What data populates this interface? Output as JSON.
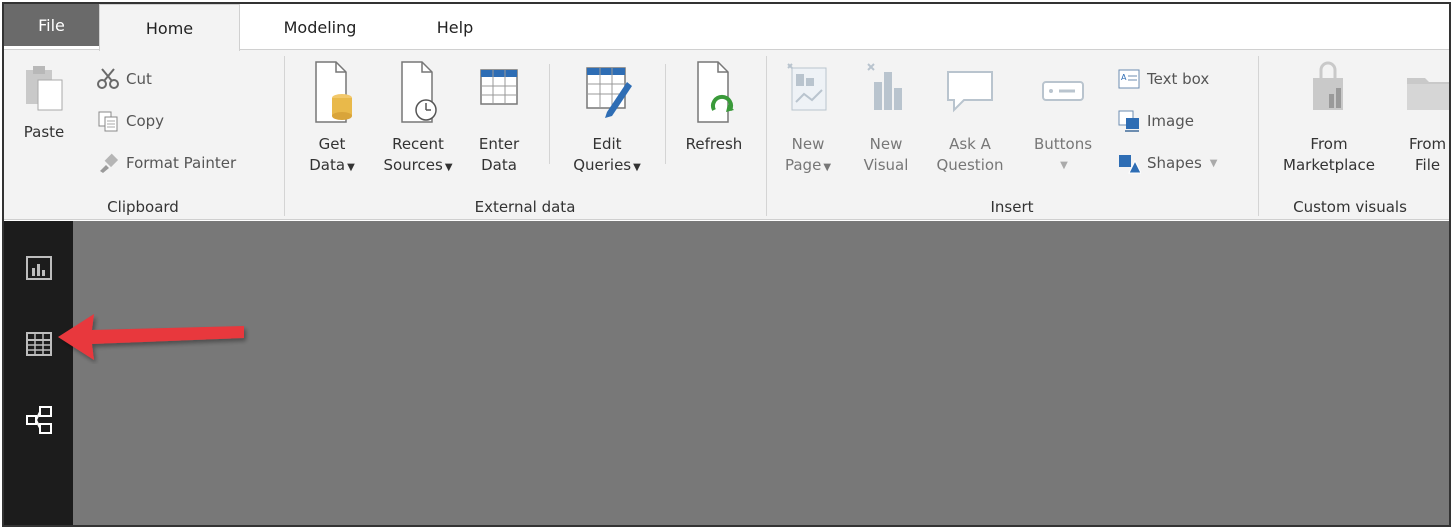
{
  "tabs": [
    {
      "label": "File"
    },
    {
      "label": "Home"
    },
    {
      "label": "Modeling"
    },
    {
      "label": "Help"
    }
  ],
  "active_tab": "Home",
  "clipboard": {
    "paste": "Paste",
    "cut": "Cut",
    "copy": "Copy",
    "format_painter": "Format Painter",
    "label": "Clipboard"
  },
  "external_data": {
    "get_data": [
      "Get",
      "Data"
    ],
    "recent_sources": [
      "Recent",
      "Sources"
    ],
    "enter_data": [
      "Enter",
      "Data"
    ],
    "edit_queries": [
      "Edit",
      "Queries"
    ],
    "refresh": "Refresh",
    "label": "External data"
  },
  "insert": {
    "new_page": [
      "New",
      "Page"
    ],
    "new_visual": [
      "New",
      "Visual"
    ],
    "ask_question": [
      "Ask A",
      "Question"
    ],
    "buttons": "Buttons",
    "text_box": "Text box",
    "image": "Image",
    "shapes": "Shapes",
    "label": "Insert"
  },
  "custom_visuals": {
    "from_marketplace": [
      "From",
      "Marketplace"
    ],
    "from_file": [
      "From",
      "File"
    ],
    "label": "Custom visuals"
  },
  "rail": [
    {
      "icon": "report-view-icon"
    },
    {
      "icon": "data-view-icon"
    },
    {
      "icon": "relationships-view-icon"
    }
  ],
  "colors": {
    "ribbon_bg": "#f3f3f3",
    "file_tab_bg": "#6a6a6a",
    "rail_bg": "#1c1c1c",
    "canvas_bg": "#787878",
    "arrow": "#e8383d",
    "accent_gold": "#e9b94a",
    "accent_blue": "#2e6db4",
    "accent_green": "#3a9a3a"
  }
}
